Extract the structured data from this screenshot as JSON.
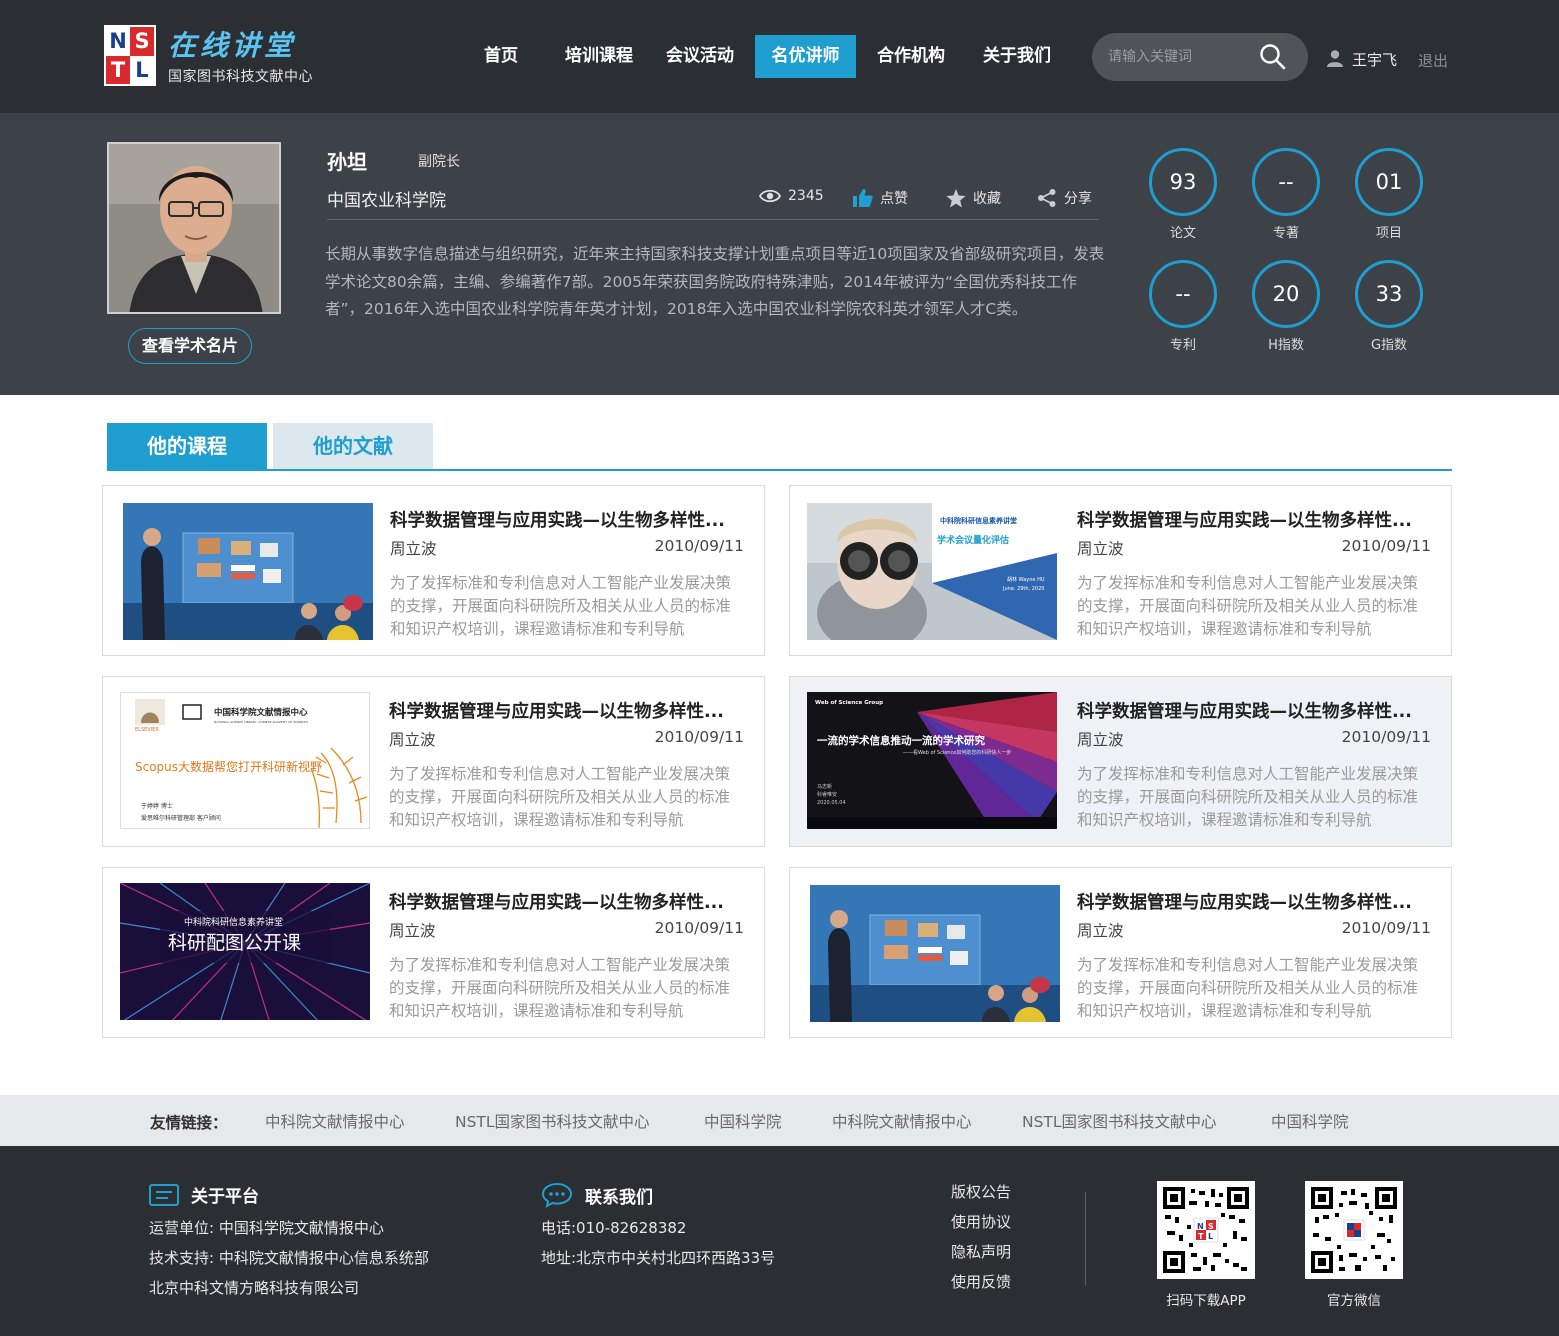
{
  "header": {
    "logo_letters": [
      "N",
      "S",
      "T",
      "L"
    ],
    "title": "在线讲堂",
    "subtitle": "国家图书科技文献中心",
    "nav": [
      {
        "label": "首页",
        "active": false
      },
      {
        "label": "培训课程",
        "active": false
      },
      {
        "label": "会议活动",
        "active": false
      },
      {
        "label": "名优讲师",
        "active": true
      },
      {
        "label": "合作机构",
        "active": false
      },
      {
        "label": "关于我们",
        "active": false
      }
    ],
    "search_placeholder": "请输入关键词",
    "user_name": "王宇飞",
    "logout": "退出"
  },
  "profile": {
    "name": "孙坦",
    "position": "副院长",
    "org": "中国农业科学院",
    "views": "2345",
    "like_label": "点赞",
    "fav_label": "收藏",
    "share_label": "分享",
    "card_button": "查看学术名片",
    "bio": "长期从事数字信息描述与组织研究，近年来主持国家科技支撑计划重点项目等近10项国家及省部级研究项目，发表学术论文80余篇，主编、参编著作7部。2005年荣获国务院政府特殊津贴，2014年被评为“全国优秀科技工作者”，2016年入选中国农业科学院青年英才计划，2018年入选中国农业科学院农科英才领军人才C类。",
    "metrics": [
      {
        "value": "93",
        "label": "论文"
      },
      {
        "value": "--",
        "label": "专著"
      },
      {
        "value": "01",
        "label": "项目"
      },
      {
        "value": "--",
        "label": "专利"
      },
      {
        "value": "20",
        "label": "H指数"
      },
      {
        "value": "33",
        "label": "G指数"
      }
    ]
  },
  "tabs": [
    {
      "label": "他的课程",
      "active": true
    },
    {
      "label": "他的文献",
      "active": false
    }
  ],
  "courses": [
    {
      "title": "科学数据管理与应用实践—以生物多样性...",
      "author": "周立波",
      "date": "2010/09/11",
      "desc": "为了发挥标准和专利信息对人工智能产业发展决策的支撑，开展面向科研院所及相关从业人员的标准和知识产权培训，课程邀请标准和专利导航",
      "thumb": "studio"
    },
    {
      "title": "科学数据管理与应用实践—以生物多样性...",
      "author": "周立波",
      "date": "2010/09/11",
      "desc": "为了发挥标准和专利信息对人工智能产业发展决策的支撑，开展面向科研院所及相关从业人员的标准和知识产权培训，课程邀请标准和专利导航",
      "thumb": "binocular",
      "thumb_text": {
        "series": "中科院科研信息素养讲堂",
        "topic": "学术会议量化评估",
        "speaker": "胡林 Wayne HU",
        "date": "June. 29th, 2020"
      }
    },
    {
      "title": "科学数据管理与应用实践—以生物多样性...",
      "author": "周立波",
      "date": "2010/09/11",
      "desc": "为了发挥标准和专利信息对人工智能产业发展决策的支撑，开展面向科研院所及相关从业人员的标准和知识产权培训，课程邀请标准和专利导航",
      "thumb": "scopus",
      "thumb_text": {
        "org": "中国科学院文献情报中心",
        "org_en": "NATIONAL SCIENCE LIBRARY, CHINESE ACADEMY OF SCIENCES",
        "publisher": "ELSEVIER",
        "headline_brand": "Scopus",
        "headline": "大数据帮您打开科研新视野",
        "speaker": "于婷婷 博士",
        "speaker_org": "爱思唯尔科研管理部 客户顾问"
      }
    },
    {
      "title": "科学数据管理与应用实践—以生物多样性...",
      "author": "周立波",
      "date": "2010/09/11",
      "desc": "为了发挥标准和专利信息对人工智能产业发展决策的支撑，开展面向科研院所及相关从业人员的标准和知识产权培训，课程邀请标准和专利导航",
      "thumb": "wos",
      "highlight": true,
      "thumb_text": {
        "brand": "Web of Science Group",
        "headline": "一流的学术信息推动一流的学术研究",
        "sub": "——看Web of Science如何助您的科研快人一步",
        "speaker": "马志新",
        "speaker_role": "科睿唯安",
        "date": "2020.05.04"
      }
    },
    {
      "title": "科学数据管理与应用实践—以生物多样性...",
      "author": "周立波",
      "date": "2010/09/11",
      "desc": "为了发挥标准和专利信息对人工智能产业发展决策的支撑，开展面向科研院所及相关从业人员的标准和知识产权培训，课程邀请标准和专利导航",
      "thumb": "burst",
      "thumb_text": {
        "series": "中科院科研信息素养讲堂",
        "headline": "科研配图公开课"
      }
    },
    {
      "title": "科学数据管理与应用实践—以生物多样性...",
      "author": "周立波",
      "date": "2010/09/11",
      "desc": "为了发挥标准和专利信息对人工智能产业发展决策的支撑，开展面向科研院所及相关从业人员的标准和知识产权培训，课程邀请标准和专利导航",
      "thumb": "studio"
    }
  ],
  "friend_links": {
    "label": "友情链接：",
    "items": [
      "中科院文献情报中心",
      "NSTL国家图书科技文献中心",
      "中国科学院",
      "中科院文献情报中心",
      "NSTL国家图书科技文献中心",
      "中国科学院"
    ]
  },
  "footer": {
    "about_title": "关于平台",
    "about_lines": [
      "运营单位: 中国科学院文献情报中心",
      "技术支持: 中科院文献情报中心信息系统部",
      "北京中科文情方略科技有限公司"
    ],
    "contact_title": "联系我们",
    "contact_lines": [
      "电话:010-82628382",
      "地址:北京市中关村北四环西路33号"
    ],
    "links": [
      "版权公告",
      "使用协议",
      "隐私声明",
      "使用反馈"
    ],
    "qr_app_label": "扫码下载APP",
    "qr_wechat_label": "官方微信"
  },
  "colors": {
    "accent": "#1f9fcf",
    "header_bg": "#2b2e33",
    "banner_bg": "#3d4148",
    "logo_red": "#d82a2d",
    "logo_blue": "#1b3f8e"
  }
}
